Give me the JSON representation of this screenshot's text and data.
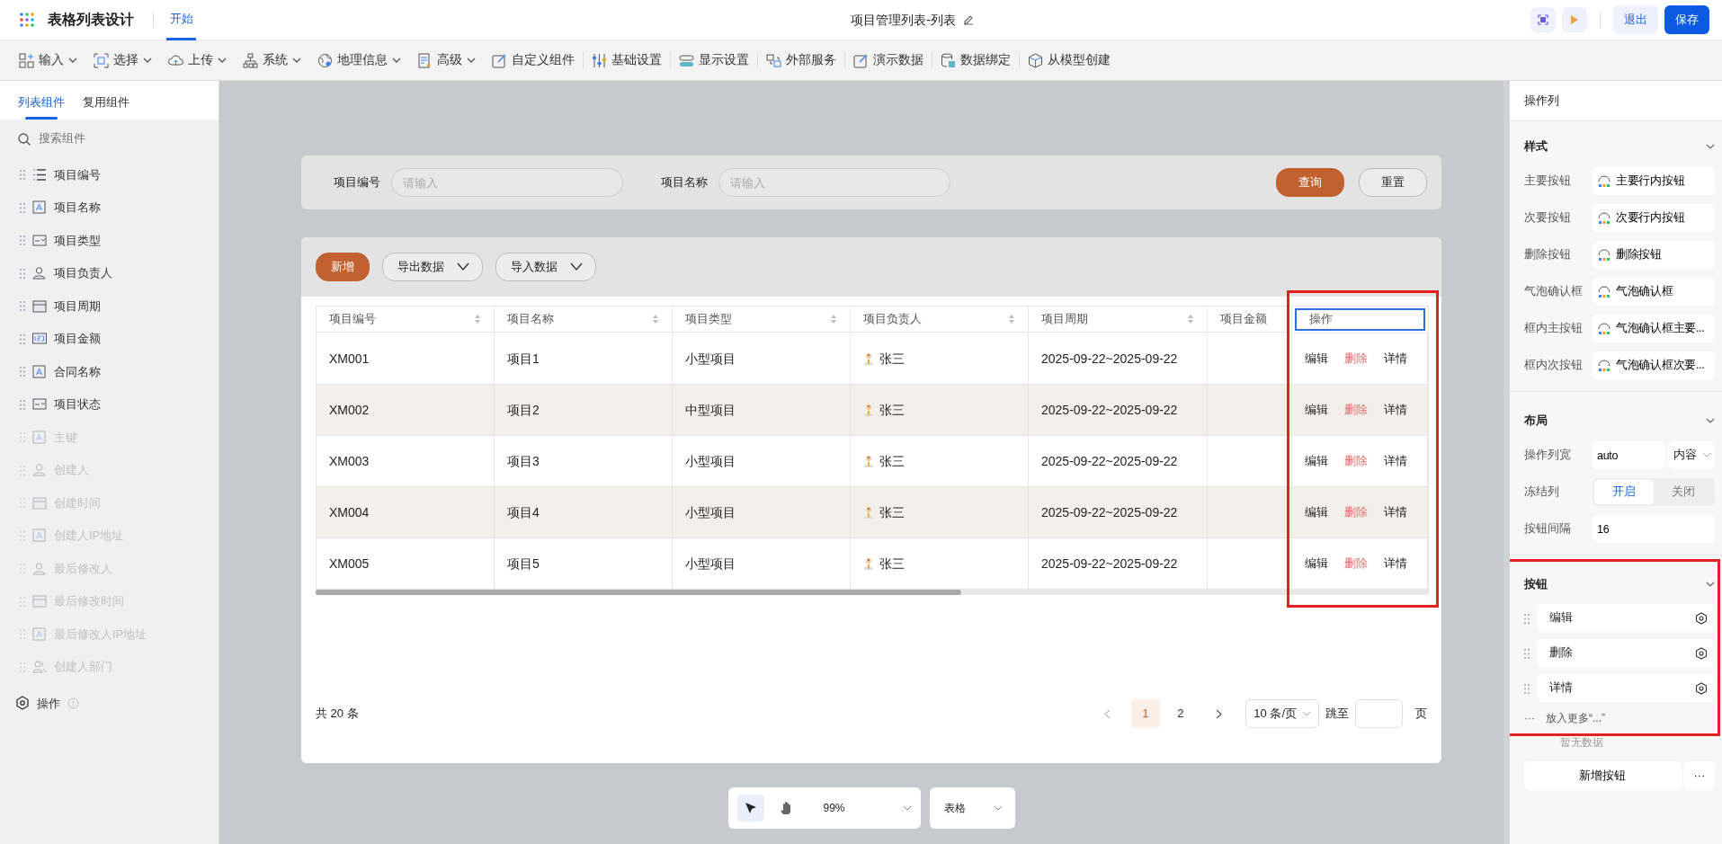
{
  "app": {
    "title": "表格列表设计",
    "tabs": [
      {
        "label": "开始",
        "selected": true
      }
    ],
    "document_title": "项目管理列表-列表",
    "buttons": [
      {
        "label": "退出",
        "kind": "secondary"
      },
      {
        "label": "保存",
        "kind": "primary"
      }
    ]
  },
  "toolbar": [
    {
      "label": "输入",
      "kind": "blocks",
      "dropdown": true
    },
    {
      "label": "选择",
      "kind": "select",
      "dropdown": true
    },
    {
      "label": "上传",
      "kind": "cloud",
      "dropdown": true
    },
    {
      "label": "系统",
      "kind": "tree",
      "dropdown": true
    },
    {
      "label": "地理信息",
      "kind": "globe",
      "dropdown": true
    },
    {
      "label": "高级",
      "kind": "doc",
      "dropdown": true
    },
    {
      "label": "自定义组件",
      "kind": "edit",
      "dropdown": false
    },
    {
      "label": "基础设置",
      "kind": "sliders",
      "dropdown": false
    },
    {
      "label": "显示设置",
      "kind": "toggle",
      "dropdown": false
    },
    {
      "label": "外部服务",
      "kind": "link",
      "dropdown": false
    },
    {
      "label": "演示数据",
      "kind": "edit",
      "dropdown": false
    },
    {
      "label": "数据绑定",
      "kind": "database",
      "dropdown": false
    },
    {
      "label": "从模型创建",
      "kind": "cube",
      "dropdown": false
    }
  ],
  "sidebar": {
    "tabs": [
      {
        "label": "列表组件",
        "selected": true
      },
      {
        "label": "复用组件",
        "selected": false
      }
    ],
    "search_placeholder": "搜索组件",
    "items": [
      {
        "label": "项目编号",
        "kind": "list",
        "disabled": false
      },
      {
        "label": "项目名称",
        "kind": "text",
        "disabled": false
      },
      {
        "label": "项目类型",
        "kind": "select",
        "disabled": false
      },
      {
        "label": "项目负责人",
        "kind": "person",
        "disabled": false
      },
      {
        "label": "项目周期",
        "kind": "calendar",
        "disabled": false
      },
      {
        "label": "项目金额",
        "kind": "number",
        "disabled": false
      },
      {
        "label": "合同名称",
        "kind": "text",
        "disabled": false
      },
      {
        "label": "项目状态",
        "kind": "select",
        "disabled": false
      },
      {
        "label": "主键",
        "kind": "text",
        "disabled": true
      },
      {
        "label": "创建人",
        "kind": "person",
        "disabled": true
      },
      {
        "label": "创建时间",
        "kind": "calendar",
        "disabled": true
      },
      {
        "label": "创建人IP地址",
        "kind": "text",
        "disabled": true
      },
      {
        "label": "最后修改人",
        "kind": "person",
        "disabled": true
      },
      {
        "label": "最后修改时间",
        "kind": "calendar",
        "disabled": true
      },
      {
        "label": "最后修改人IP地址",
        "kind": "text",
        "disabled": true
      },
      {
        "label": "创建人部门",
        "kind": "group",
        "disabled": true
      }
    ],
    "footer": {
      "label": "操作"
    }
  },
  "filter": {
    "fields": [
      {
        "label": "项目编号",
        "placeholder": "请输入"
      },
      {
        "label": "项目名称",
        "placeholder": "请输入"
      }
    ],
    "buttons": [
      {
        "label": "查询",
        "kind": "primary"
      },
      {
        "label": "重置",
        "kind": "default"
      }
    ]
  },
  "actions": [
    {
      "label": "新增",
      "kind": "primary"
    },
    {
      "label": "导出数据",
      "kind": "dropdown"
    },
    {
      "label": "导入数据",
      "kind": "dropdown"
    }
  ],
  "table": {
    "columns": [
      {
        "label": "项目编号",
        "sortable": true,
        "selected": false
      },
      {
        "label": "项目名称",
        "sortable": true,
        "selected": false
      },
      {
        "label": "项目类型",
        "sortable": true,
        "selected": false
      },
      {
        "label": "项目负责人",
        "sortable": true,
        "selected": false
      },
      {
        "label": "项目周期",
        "sortable": true,
        "selected": false
      },
      {
        "label": "项目金额",
        "sortable": false,
        "selected": false
      },
      {
        "label": "操作",
        "sortable": false,
        "selected": true
      }
    ],
    "operation_column_highlighted": true,
    "rows": [
      {
        "code": "XM001",
        "name": "项目1",
        "type": "小型项目",
        "owner": "张三",
        "period": "2025-09-22~2025-09-22",
        "actions": [
          {
            "label": "编辑",
            "kind": "normal"
          },
          {
            "label": "删除",
            "kind": "danger"
          },
          {
            "label": "详情",
            "kind": "normal"
          }
        ]
      },
      {
        "code": "XM002",
        "name": "项目2",
        "type": "中型项目",
        "owner": "张三",
        "period": "2025-09-22~2025-09-22",
        "actions": [
          {
            "label": "编辑",
            "kind": "normal"
          },
          {
            "label": "删除",
            "kind": "danger"
          },
          {
            "label": "详情",
            "kind": "normal"
          }
        ]
      },
      {
        "code": "XM003",
        "name": "项目3",
        "type": "小型项目",
        "owner": "张三",
        "period": "2025-09-22~2025-09-22",
        "actions": [
          {
            "label": "编辑",
            "kind": "normal"
          },
          {
            "label": "删除",
            "kind": "danger"
          },
          {
            "label": "详情",
            "kind": "normal"
          }
        ]
      },
      {
        "code": "XM004",
        "name": "项目4",
        "type": "小型项目",
        "owner": "张三",
        "period": "2025-09-22~2025-09-22",
        "actions": [
          {
            "label": "编辑",
            "kind": "normal"
          },
          {
            "label": "删除",
            "kind": "danger"
          },
          {
            "label": "详情",
            "kind": "normal"
          }
        ]
      },
      {
        "code": "XM005",
        "name": "项目5",
        "type": "小型项目",
        "owner": "张三",
        "period": "2025-09-22~2025-09-22",
        "actions": [
          {
            "label": "编辑",
            "kind": "normal"
          },
          {
            "label": "删除",
            "kind": "danger"
          },
          {
            "label": "详情",
            "kind": "normal"
          }
        ]
      }
    ]
  },
  "pagination": {
    "total": "共 20 条",
    "pages": [
      {
        "label": "1",
        "selected": true
      },
      {
        "label": "2",
        "selected": false
      }
    ],
    "page_size": "10 条/页",
    "jump_label": "跳至",
    "page_unit": "页"
  },
  "canvas_toolbar": {
    "tools": [
      {
        "kind": "pointer",
        "selected": true
      },
      {
        "kind": "hand",
        "selected": false
      }
    ],
    "zoom": "99%",
    "view": "表格"
  },
  "properties": {
    "title": "操作列",
    "style": {
      "title": "样式",
      "rows": [
        {
          "label": "主要按钮",
          "value": "主要行内按钮"
        },
        {
          "label": "次要按钮",
          "value": "次要行内按钮"
        },
        {
          "label": "删除按钮",
          "value": "删除按钮"
        },
        {
          "label": "气泡确认框",
          "value": "气泡确认框"
        },
        {
          "label": "框内主按钮",
          "value": "气泡确认框主要..."
        },
        {
          "label": "框内次按钮",
          "value": "气泡确认框次要..."
        }
      ]
    },
    "layout": {
      "title": "布局",
      "width_label": "操作列宽",
      "width_value": "auto",
      "width_unit": "内容",
      "freeze_label": "冻结列",
      "freeze_options": [
        {
          "label": "开启",
          "selected": true
        },
        {
          "label": "关闭",
          "selected": false
        }
      ],
      "gap_label": "按钮间隔",
      "gap_value": "16"
    },
    "buttons": {
      "title": "按钮",
      "highlighted": true,
      "items": [
        {
          "label": "编辑"
        },
        {
          "label": "删除"
        },
        {
          "label": "详情"
        }
      ],
      "more_icon": "···",
      "more_label": "放入更多“...”"
    },
    "empty_text": "暂无数据",
    "add_button": "新增按钮",
    "more_button": "···"
  }
}
